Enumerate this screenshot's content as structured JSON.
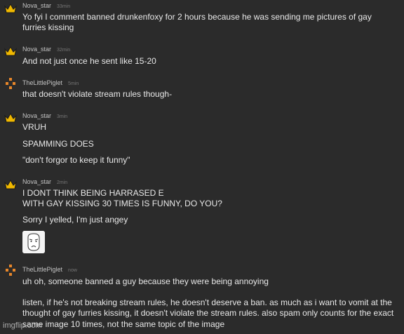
{
  "messages": [
    {
      "user": "Nova_star",
      "avatar": "crown-icon",
      "time": "33min",
      "lines": [
        "Yo fyi I comment banned drunkenfoxy for 2 hours because he was sending me pictures of gay",
        "furries kissing"
      ]
    },
    {
      "user": "Nova_star",
      "avatar": "crown-icon",
      "time": "32min",
      "lines": [
        "And not just once he sent like 15-20"
      ]
    },
    {
      "user": "TheLittlePiglet",
      "avatar": "pixel-flower-icon",
      "time": "5min",
      "lines": [
        "that doesn't violate stream rules though-"
      ]
    },
    {
      "user": "Nova_star",
      "avatar": "crown-icon",
      "time": "3min",
      "lines": [
        "VRUH",
        "SPAMMING DOES",
        "\"don't forgor to keep it funny\""
      ]
    },
    {
      "user": "Nova_star",
      "avatar": "crown-icon",
      "time": "2min",
      "lines": [
        "I DONT THINK BEING HARRASED E",
        "WITH GAY KISSING 30 TIMES IS FUNNY, DO YOU?",
        "Sorry I yelled, I'm just angey"
      ],
      "sticker": "sad-face-sticker"
    },
    {
      "user": "TheLittlePiglet",
      "avatar": "pixel-flower-icon",
      "time": "now",
      "lines": [
        "uh oh, someone banned a guy because they were being annoying",
        "listen, if he's not breaking stream rules, he doesn't deserve a ban. as much as i want to vomit at the",
        "thought of gay furries kissing, it doesn't violate the stream rules. also spam only counts for the exact",
        "same image 10 times, not the same topic of the image"
      ]
    }
  ],
  "watermark": "imgflip.com",
  "colors": {
    "background": "#2b2b2b",
    "crown": "#f0b800",
    "flower": "#e8872a"
  }
}
